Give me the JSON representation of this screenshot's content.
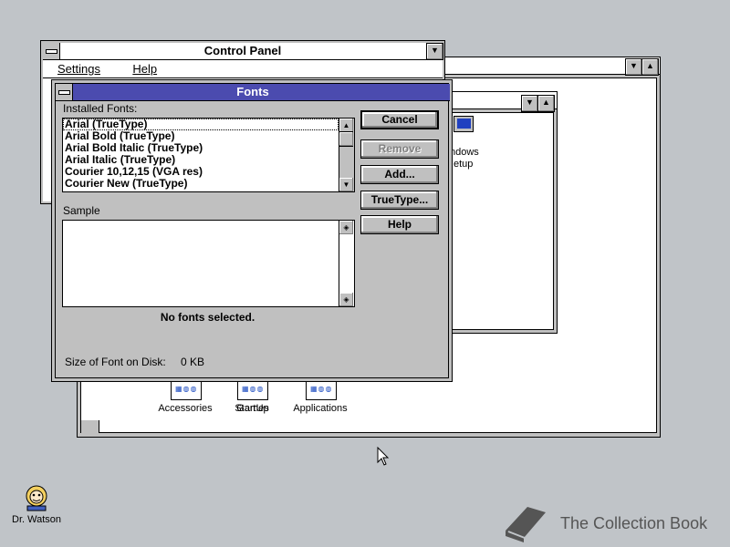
{
  "control_panel": {
    "title": "Control Panel",
    "menu": [
      {
        "label": "Settings"
      },
      {
        "label": "Help"
      }
    ]
  },
  "fonts_dialog": {
    "title": "Fonts",
    "installed_label": "Installed Fonts:",
    "fonts": [
      "Arial (TrueType)",
      "Arial Bold (TrueType)",
      "Arial Bold Italic (TrueType)",
      "Arial Italic (TrueType)",
      "Courier 10,12,15 (VGA res)",
      "Courier New (TrueType)"
    ],
    "sample_label": "Sample",
    "status": "No fonts selected.",
    "size_label": "Size of Font on Disk:",
    "size_value": "0 KB",
    "buttons": {
      "cancel": "Cancel",
      "remove": "Remove",
      "add": "Add...",
      "truetype": "TrueType...",
      "help": "Help"
    }
  },
  "main_group": {
    "icons": [
      "Accessories",
      "Games",
      "StartUp",
      "Applications"
    ]
  },
  "sub_window": {
    "icon_label_line1": "ndows",
    "icon_label_line2": "etup"
  },
  "desktop": {
    "dr_watson": "Dr. Watson",
    "watermark": "The Collection Book"
  }
}
